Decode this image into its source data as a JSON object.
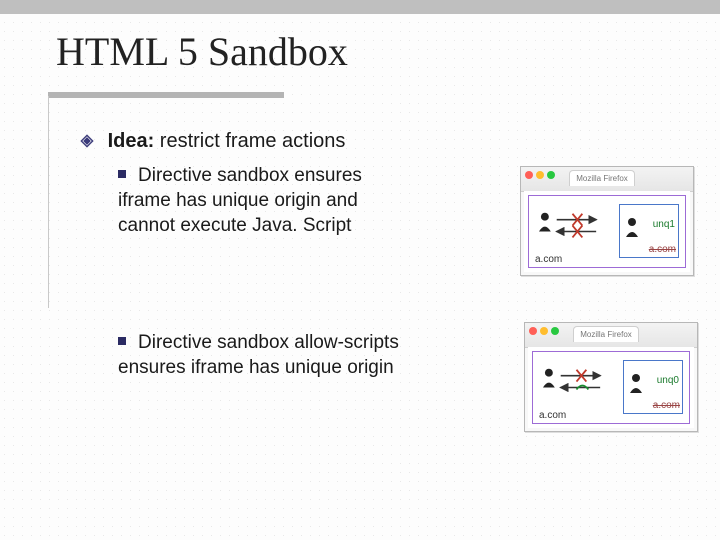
{
  "slide": {
    "title": "HTML 5 Sandbox",
    "idea_label": "Idea:",
    "idea_text": " restrict frame actions",
    "bullets": [
      "Directive sandbox ensures iframe has unique origin and cannot execute Java. Script",
      "Directive sandbox allow-scripts ensures iframe has unique origin"
    ]
  },
  "mockups": [
    {
      "tab_title": "Mozilla Firefox",
      "outer_origin": "a.com",
      "inner_origin_shown": "a.com",
      "inner_label": "unq1",
      "left_to_right_blocked": true,
      "right_to_left_blocked": true,
      "origin_struck": true
    },
    {
      "tab_title": "Mozilla Firefox",
      "outer_origin": "a.com",
      "inner_origin_shown": "a.com",
      "inner_label": "unq0",
      "left_to_right_blocked": true,
      "right_to_left_blocked": false,
      "origin_struck": true
    }
  ]
}
